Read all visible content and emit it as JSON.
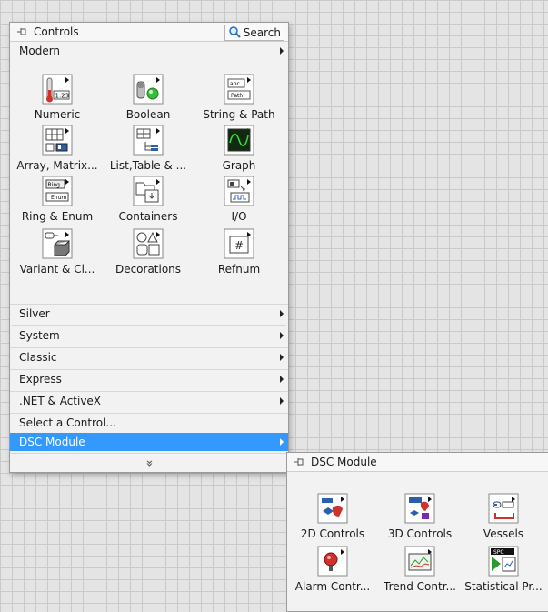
{
  "palette": {
    "title": "Controls",
    "search_label": "Search",
    "first_category": "Modern",
    "icons": [
      {
        "label": "Numeric",
        "icon": "numeric-icon"
      },
      {
        "label": "Boolean",
        "icon": "boolean-icon"
      },
      {
        "label": "String & Path",
        "icon": "string-path-icon"
      },
      {
        "label": "Array, Matrix...",
        "icon": "array-matrix-icon"
      },
      {
        "label": "List,Table & ...",
        "icon": "list-table-icon"
      },
      {
        "label": "Graph",
        "icon": "graph-icon"
      },
      {
        "label": "Ring & Enum",
        "icon": "ring-enum-icon"
      },
      {
        "label": "Containers",
        "icon": "containers-icon"
      },
      {
        "label": "I/O",
        "icon": "io-icon"
      },
      {
        "label": "Variant & Cl...",
        "icon": "variant-class-icon"
      },
      {
        "label": "Decorations",
        "icon": "decorations-icon"
      },
      {
        "label": "Refnum",
        "icon": "refnum-icon"
      }
    ],
    "categories": [
      {
        "label": "Silver",
        "submenu": true
      },
      {
        "label": "System",
        "submenu": true
      },
      {
        "label": "Classic",
        "submenu": true
      },
      {
        "label": "Express",
        "submenu": true
      },
      {
        "label": ".NET & ActiveX",
        "submenu": true
      },
      {
        "label": "Select a Control...",
        "submenu": false
      },
      {
        "label": "DSC Module",
        "submenu": true,
        "selected": true
      }
    ],
    "expand_glyph": "»"
  },
  "sub_palette": {
    "title": "DSC Module",
    "icons": [
      {
        "label": "2D Controls",
        "icon": "2d-controls-icon"
      },
      {
        "label": "3D Controls",
        "icon": "3d-controls-icon"
      },
      {
        "label": "Vessels",
        "icon": "vessels-icon"
      },
      {
        "label": "Alarm Contr...",
        "icon": "alarm-controls-icon"
      },
      {
        "label": "Trend Contr...",
        "icon": "trend-controls-icon"
      },
      {
        "label": "Statistical Pr...",
        "icon": "statistical-process-icon"
      }
    ]
  },
  "colors": {
    "selection": "#3399ff",
    "canvas_grid": "#c9c9c9",
    "palette_bg": "#f2f2f2"
  }
}
